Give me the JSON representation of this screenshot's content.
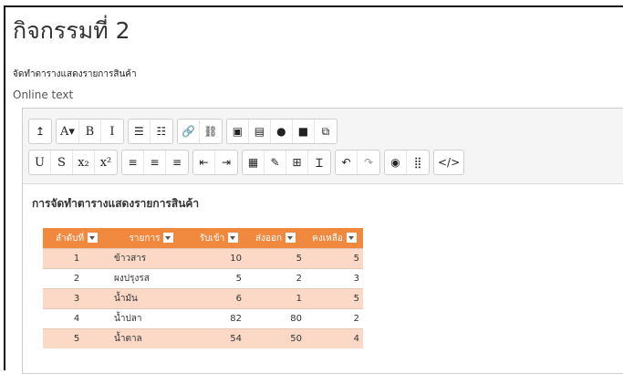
{
  "page": {
    "title": "กิจกรรมที่ 2",
    "description": "จัดทำตารางแสดงรายการสินค้า",
    "online_text_label": "Online text"
  },
  "toolbar": {
    "row1": [
      [
        {
          "name": "show-more-icon",
          "glyph": "↥"
        }
      ],
      [
        {
          "name": "font-style-dropdown",
          "glyph": "A▾"
        },
        {
          "name": "bold-button",
          "glyph": "B"
        },
        {
          "name": "italic-button",
          "glyph": "I"
        }
      ],
      [
        {
          "name": "bullet-list-icon",
          "glyph": "☰"
        },
        {
          "name": "numbered-list-icon",
          "glyph": "☷"
        }
      ],
      [
        {
          "name": "link-icon",
          "glyph": "🔗"
        },
        {
          "name": "unlink-icon",
          "glyph": "⛓"
        }
      ],
      [
        {
          "name": "image-icon",
          "glyph": "▣"
        },
        {
          "name": "media-icon",
          "glyph": "▤"
        },
        {
          "name": "record-audio-icon",
          "glyph": "●"
        },
        {
          "name": "record-video-icon",
          "glyph": "■"
        },
        {
          "name": "manage-files-icon",
          "glyph": "⧉"
        }
      ]
    ],
    "row2": [
      [
        {
          "name": "underline-button",
          "glyph": "U"
        },
        {
          "name": "strikethrough-button",
          "glyph": "S"
        },
        {
          "name": "subscript-button",
          "glyph": "x₂"
        },
        {
          "name": "superscript-button",
          "glyph": "x²"
        }
      ],
      [
        {
          "name": "align-left-icon",
          "glyph": "≡"
        },
        {
          "name": "align-center-icon",
          "glyph": "≡"
        },
        {
          "name": "align-right-icon",
          "glyph": "≡"
        }
      ],
      [
        {
          "name": "outdent-icon",
          "glyph": "⇤"
        },
        {
          "name": "indent-icon",
          "glyph": "⇥"
        }
      ],
      [
        {
          "name": "equation-icon",
          "glyph": "▦"
        },
        {
          "name": "edit-icon",
          "glyph": "✎"
        },
        {
          "name": "table-icon",
          "glyph": "⊞"
        },
        {
          "name": "clear-formatting-icon",
          "glyph": "Ɪ"
        }
      ],
      [
        {
          "name": "undo-icon",
          "glyph": "↶"
        },
        {
          "name": "redo-icon",
          "glyph": "↷"
        }
      ],
      [
        {
          "name": "accessibility-checker-icon",
          "glyph": "◉"
        },
        {
          "name": "screenreader-helper-icon",
          "glyph": "⣿"
        }
      ],
      [
        {
          "name": "html-icon",
          "glyph": "</>"
        }
      ]
    ]
  },
  "content": {
    "heading": "การจัดทำตารางแสดงรายการสินค้า",
    "table": {
      "headers": [
        "ลำดับที่",
        "รายการ",
        "รับเข้า",
        "ส่งออก",
        "คงเหลือ"
      ],
      "rows": [
        [
          "1",
          "ข้าวสาร",
          "10",
          "5",
          "5"
        ],
        [
          "2",
          "ผงปรุงรส",
          "5",
          "2",
          "3"
        ],
        [
          "3",
          "น้ำมัน",
          "6",
          "1",
          "5"
        ],
        [
          "4",
          "น้ำปลา",
          "82",
          "80",
          "2"
        ],
        [
          "5",
          "น้ำตาล",
          "54",
          "50",
          "4"
        ]
      ]
    }
  },
  "colors": {
    "header": "#f0883e",
    "band": "#fbd9c6"
  }
}
